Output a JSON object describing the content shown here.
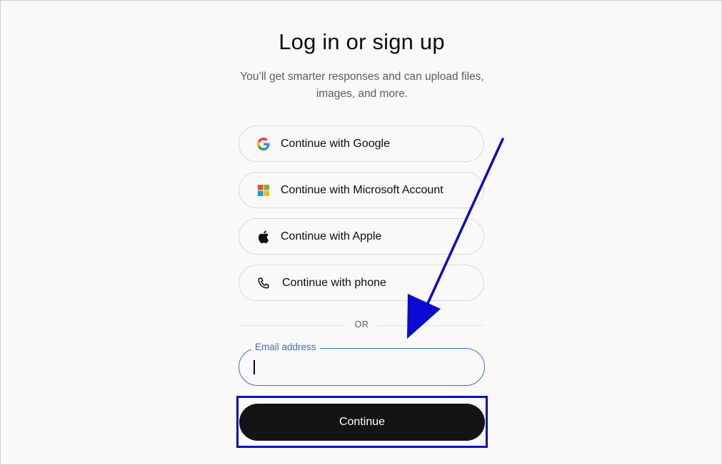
{
  "auth": {
    "title": "Log in or sign up",
    "subtitle": "You’ll get smarter responses and can upload files, images, and more.",
    "providers": [
      {
        "label": "Continue with Google",
        "icon": "google-icon"
      },
      {
        "label": "Continue with Microsoft Account",
        "icon": "microsoft-icon"
      },
      {
        "label": "Continue with Apple",
        "icon": "apple-icon"
      },
      {
        "label": "Continue with phone",
        "icon": "phone-icon"
      }
    ],
    "divider": "OR",
    "email": {
      "label": "Email address",
      "value": ""
    },
    "continue_label": "Continue"
  },
  "annotation": {
    "highlight_color": "#0a0ad4",
    "arrow_color": "#0a0ad4"
  },
  "colors": {
    "accent": "#3e6fd0",
    "primary_button": "#141414"
  }
}
